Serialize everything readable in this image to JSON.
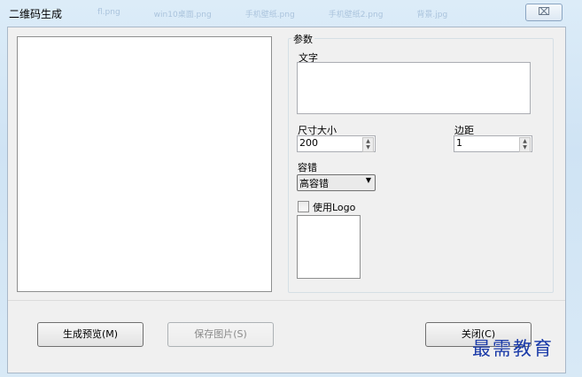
{
  "window": {
    "title": "二维码生成",
    "close_glyph": "⌧"
  },
  "background_tabs": [
    "fl.png",
    "win10桌面.png",
    "手机壁纸.png",
    "手机壁纸2.png",
    "背景.jpg"
  ],
  "params": {
    "legend": "参数",
    "text_label": "文字",
    "text_value": "",
    "size_label": "尺寸大小",
    "size_value": "200",
    "margin_label": "边距",
    "margin_value": "1",
    "tolerance_label": "容错",
    "tolerance_value": "高容错",
    "use_logo_label": "使用Logo",
    "use_logo_checked": false
  },
  "buttons": {
    "preview": "生成预览(M)",
    "save": "保存图片(S)",
    "close": "关闭(C)"
  },
  "watermark": "最需教育"
}
